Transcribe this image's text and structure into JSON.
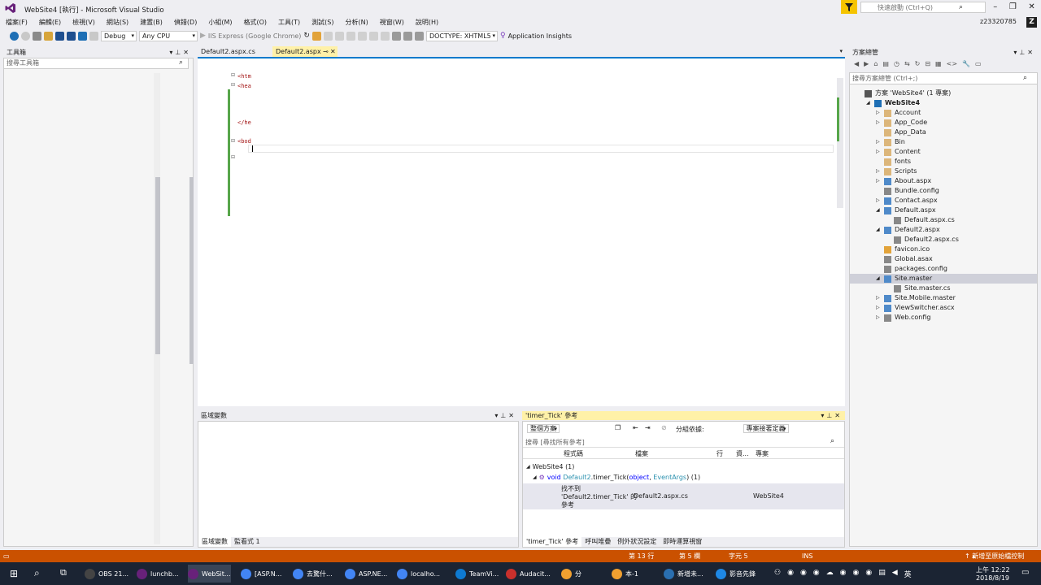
{
  "window": {
    "title": "WebSite4 [執行] - Microsoft Visual Studio"
  },
  "quick_launch": {
    "placeholder": "快速啟動 (Ctrl+Q)"
  },
  "menu": [
    "檔案(F)",
    "編輯(E)",
    "檢視(V)",
    "網站(S)",
    "建置(B)",
    "偵錯(D)",
    "小組(M)",
    "格式(O)",
    "工具(T)",
    "測試(S)",
    "分析(N)",
    "視窗(W)",
    "說明(H)"
  ],
  "account": {
    "name": "z23320785",
    "avatar": "Z"
  },
  "toolbar": {
    "config": "Debug",
    "platform": "Any CPU",
    "run_target": "IIS Express (Google Chrome)",
    "doctype": "DOCTYPE: XHTML5",
    "insights": "Application Insights"
  },
  "toolbox": {
    "title": "工具箱",
    "search_placeholder": "搜尋工具箱"
  },
  "editor": {
    "tabs": [
      {
        "label": "Default2.aspx.cs"
      },
      {
        "label": "Default2.aspx"
      }
    ],
    "lines": [
      "<htm",
      "<hea",
      "</he",
      "<bod"
    ]
  },
  "locals": {
    "title": "區域變數",
    "tabs": [
      "區域變數",
      "監看式 1"
    ]
  },
  "refs": {
    "title": "'timer_Tick' 參考",
    "scope": "整個方案",
    "group_label": "分組依據:",
    "group_value": "專案接著定義",
    "search_placeholder": "搜尋 [尋找所有參考]",
    "columns": [
      "程式碼",
      "檔案",
      "行",
      "資...",
      "專案"
    ],
    "tree_root": "WebSite4",
    "tree_root_count": "(1)",
    "method_prefix": "void",
    "method_class": "Default2",
    "method_name": ".timer_Tick(",
    "param1": "object",
    "param2": "EventArgs",
    "method_count": ") (1)",
    "result_line1": "找不到",
    "result_line2": "'Default2.timer_Tick' 的",
    "result_line3": "參考",
    "result_file": "Default2.aspx.cs",
    "result_project": "WebSite4",
    "tabs": [
      "'timer_Tick' 參考",
      "呼叫堆疊",
      "例外狀況設定",
      "即時運算視窗"
    ]
  },
  "solution": {
    "title": "方案總管",
    "search_placeholder": "搜尋方案總管 (Ctrl+;)",
    "root": "方案 'WebSite4' (1 專案)",
    "project": "WebSite4",
    "items": [
      "Account",
      "App_Code",
      "App_Data",
      "Bin",
      "Content",
      "fonts",
      "Scripts",
      "About.aspx",
      "Bundle.config",
      "Contact.aspx",
      "Default.aspx",
      "Default.aspx.cs",
      "Default2.aspx",
      "Default2.aspx.cs",
      "favicon.ico",
      "Global.asax",
      "packages.config",
      "Site.master",
      "Site.master.cs",
      "Site.Mobile.master",
      "ViewSwitcher.ascx",
      "Web.config"
    ]
  },
  "status": {
    "line": "第 13 行",
    "col": "第 5 欄",
    "char": "字元 5",
    "mode": "INS",
    "right": "新增至原始檔控制"
  },
  "taskbar": {
    "items": [
      "OBS 21...",
      "lunchb...",
      "WebSit...",
      "[ASP.N...",
      "去驚什...",
      "ASP.NE...",
      "localho...",
      "TeamVi...",
      "Audacit...",
      "分",
      "本-1",
      "新增未...",
      "影音先鋒"
    ],
    "ime": "英",
    "time": "上午 12:22",
    "date": "2018/8/19"
  }
}
